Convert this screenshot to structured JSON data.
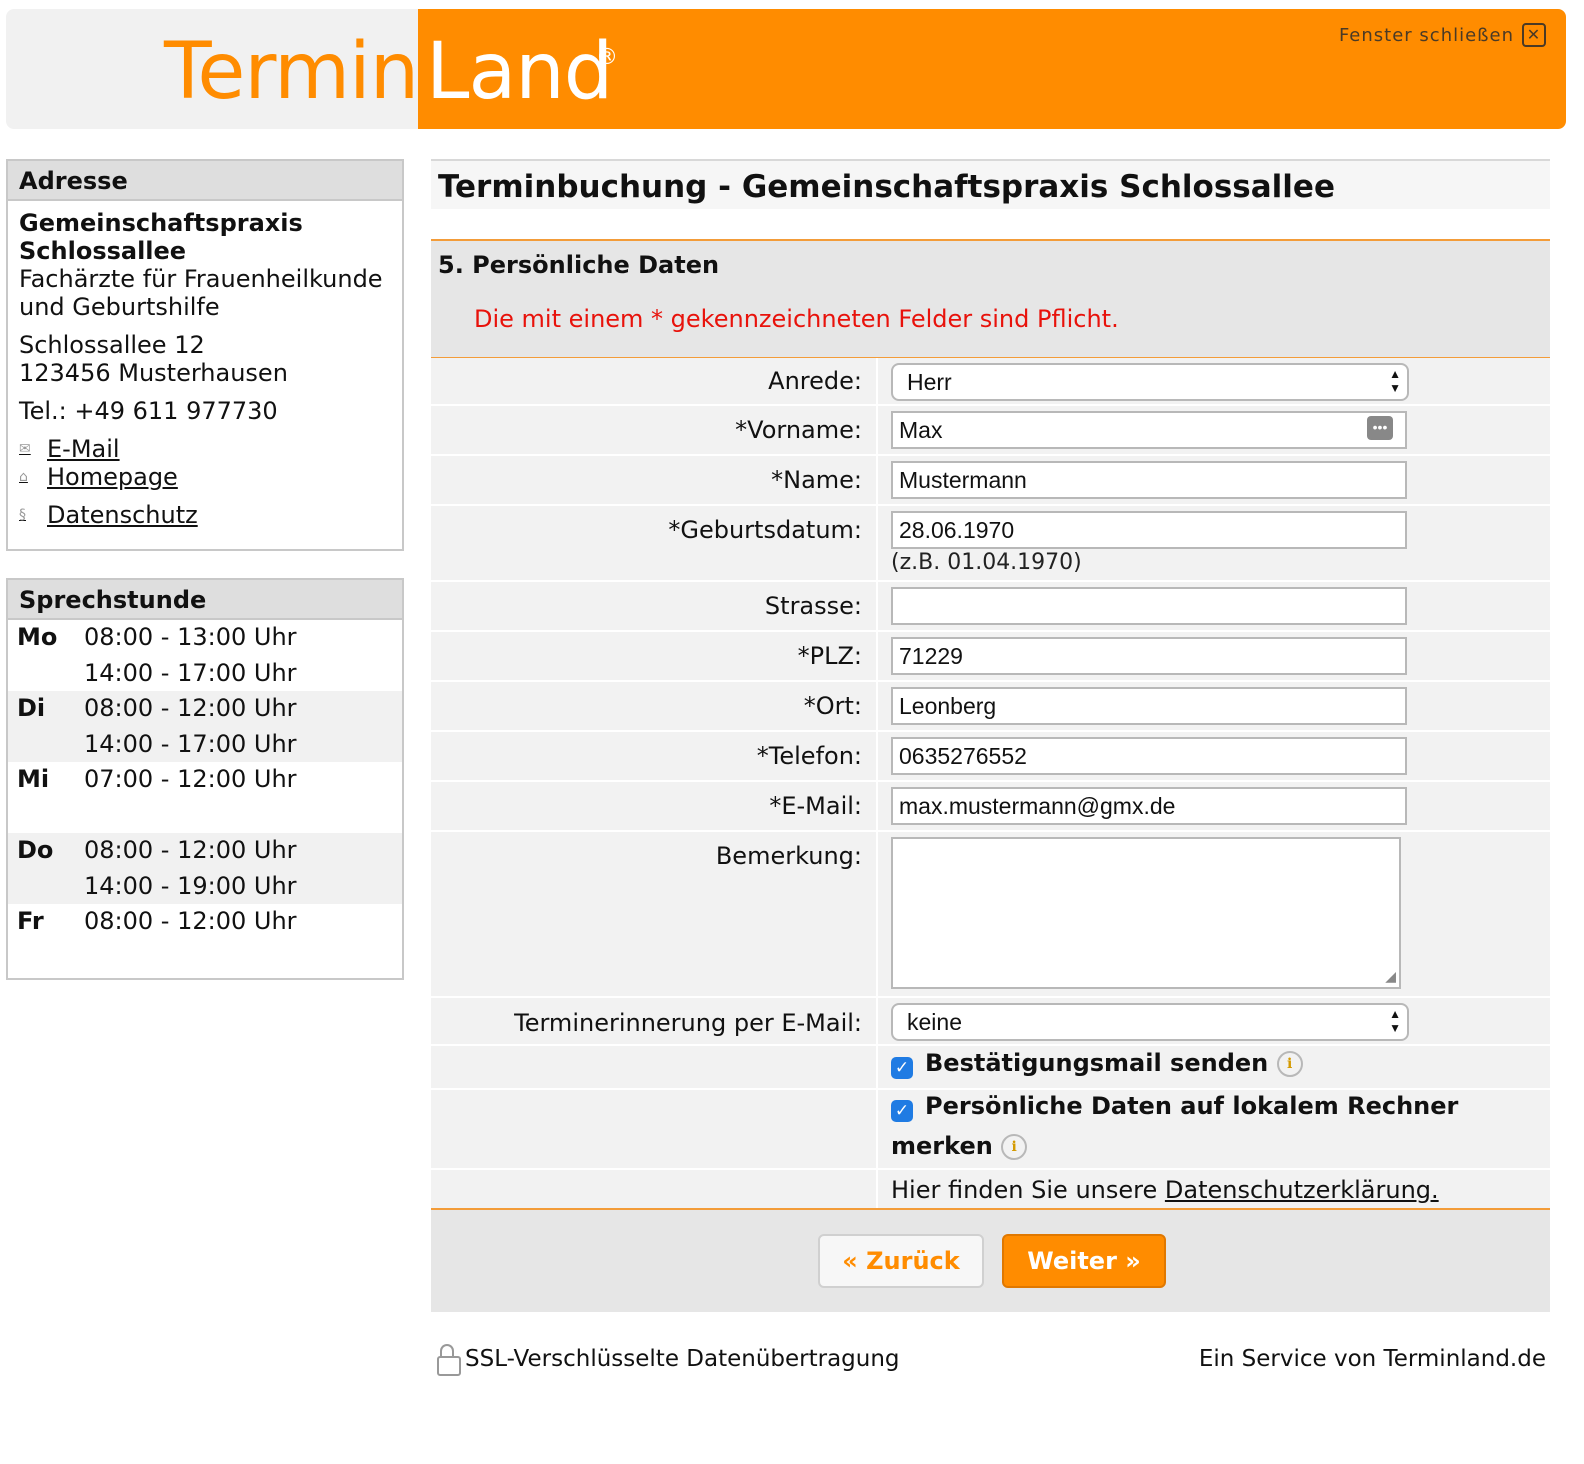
{
  "header": {
    "logo_part1": "Termin",
    "logo_part2": "Land",
    "logo_reg": "®",
    "close_label": "Fenster schließen",
    "close_icon": "close-x-icon"
  },
  "address": {
    "title": "Adresse",
    "name_line1": "Gemeinschaftspraxis",
    "name_line2": "Schlossallee",
    "specialty_line1": "Fachärzte für Frauenheilkunde",
    "specialty_line2": "und Geburtshilfe",
    "street": "Schlossallee 12",
    "city": "123456 Musterhausen",
    "phone": "Tel.: +49 611 977730",
    "links": [
      {
        "label": "E-Mail",
        "icon": "mail-icon"
      },
      {
        "label": "Homepage",
        "icon": "home-icon"
      },
      {
        "label": "Datenschutz",
        "icon": "paragraph-icon"
      }
    ]
  },
  "hours": {
    "title": "Sprechstunde",
    "days": [
      {
        "day": "Mo",
        "slot1": "08:00 - 13:00 Uhr",
        "slot2": "14:00 - 17:00 Uhr"
      },
      {
        "day": "Di",
        "slot1": "08:00 - 12:00 Uhr",
        "slot2": "14:00 - 17:00 Uhr"
      },
      {
        "day": "Mi",
        "slot1": "07:00 - 12:00 Uhr",
        "slot2": ""
      },
      {
        "day": "Do",
        "slot1": "08:00 - 12:00 Uhr",
        "slot2": "14:00 - 19:00 Uhr"
      },
      {
        "day": "Fr",
        "slot1": "08:00 - 12:00 Uhr",
        "slot2": ""
      }
    ]
  },
  "main": {
    "title": "Terminbuchung - Gemeinschaftspraxis Schlossallee",
    "section_title": "5. Persönliche Daten",
    "required_note": "Die mit einem * gekennzeichneten Felder sind Pflicht."
  },
  "form": {
    "anrede_label": "Anrede:",
    "anrede_value": "Herr",
    "vorname_label": "*Vorname:",
    "vorname_value": "Max",
    "name_label": "*Name:",
    "name_value": "Mustermann",
    "geburtsdatum_label": "*Geburtsdatum:",
    "geburtsdatum_value": "28.06.1970",
    "geburtsdatum_hint": "(z.B. 01.04.1970)",
    "strasse_label": "Strasse:",
    "strasse_value": "",
    "plz_label": "*PLZ:",
    "plz_value": "71229",
    "ort_label": "*Ort:",
    "ort_value": "Leonberg",
    "telefon_label": "*Telefon:",
    "telefon_value": "0635276552",
    "email_label": "*E-Mail:",
    "email_value": "max.mustermann@gmx.de",
    "bemerkung_label": "Bemerkung:",
    "bemerkung_value": "",
    "reminder_label": "Terminerinnerung per E-Mail:",
    "reminder_value": "keine",
    "confirm_label": "Bestätigungsmail senden",
    "confirm_checked": true,
    "remember_label_line1": "Persönliche Daten auf lokalem Rechner",
    "remember_label_line2": "merken",
    "remember_checked": true,
    "privacy_text": "Hier finden Sie unsere",
    "privacy_link": "Datenschutzerklärung."
  },
  "buttons": {
    "back": "« Zurück",
    "next": "Weiter »"
  },
  "footer": {
    "ssl": "SSL-Verschlüsselte Datenübertragung",
    "service": "Ein Service von Terminland.de"
  },
  "colors": {
    "brand_orange": "#ff8c00",
    "required_red": "#e8120b",
    "checkbox_blue": "#1f7be3"
  }
}
